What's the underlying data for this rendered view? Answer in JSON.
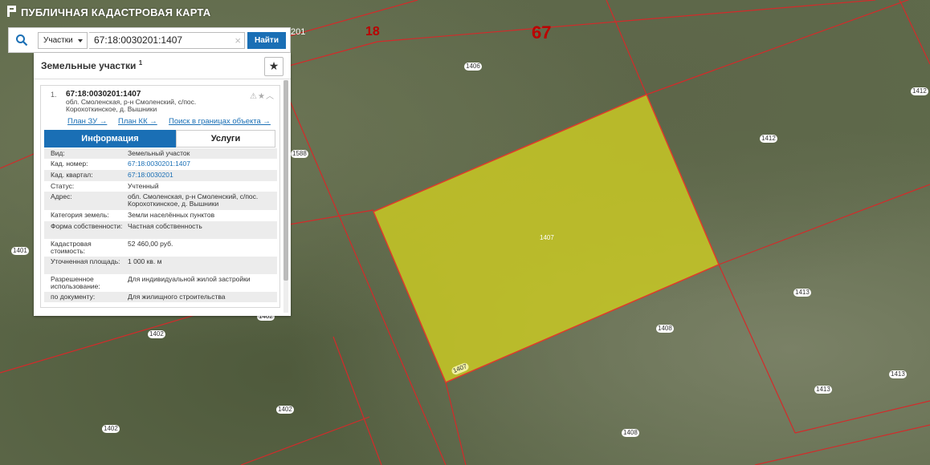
{
  "header": {
    "app_title": "ПУБЛИЧНАЯ КАДАСТРОВАЯ КАРТА"
  },
  "search": {
    "scope": "Участки",
    "query": "67:18:0030201:1407",
    "find_label": "Найти"
  },
  "panel": {
    "title": "Земельные участки",
    "count": "1",
    "item": {
      "num": "1.",
      "cad_number": "67:18:0030201:1407",
      "address": "обл. Смоленская, р-н Смоленский, с/пос. Корохоткинское, д. Вышники",
      "links": {
        "plan_zu": "План ЗУ →",
        "plan_kk": "План КК →",
        "search_within": "Поиск в границах объекта →"
      }
    },
    "tabs": {
      "info": "Информация",
      "services": "Услуги"
    },
    "rows": [
      {
        "k": "Вид:",
        "v": "Земельный участок"
      },
      {
        "k": "Кад. номер:",
        "v": "67:18:0030201:1407"
      },
      {
        "k": "Кад. квартал:",
        "v": "67:18:0030201"
      },
      {
        "k": "Статус:",
        "v": "Учтенный"
      },
      {
        "k": "Адрес:",
        "v": "обл. Смоленская, р-н Смоленский, с/пос. Корохоткинское, д. Вышники"
      },
      {
        "k": "Категория земель:",
        "v": "Земли населённых пунктов"
      },
      {
        "k": "Форма собственности:",
        "v": "Частная собственность"
      },
      {
        "k": "Кадастровая стоимость:",
        "v": "52 460,00 руб."
      },
      {
        "k": "Уточненная площадь:",
        "v": "1 000 кв. м"
      },
      {
        "k": "Разрешенное использование:",
        "v": "Для индивидуальной жилой застройки"
      },
      {
        "k": "по документу:",
        "v": "Для жилищного строительства"
      }
    ]
  },
  "map": {
    "big_labels": {
      "q18": "18",
      "q67": "67",
      "q201": "201"
    },
    "labels": {
      "l1406": "1406",
      "l1412a": "1412",
      "l1412b": "1412",
      "l1588": "1588",
      "l1407c": "1407",
      "l1407e": "1407",
      "l1401": "1401",
      "l1402a": "1402",
      "l1402b": "1402",
      "l1402c": "1402",
      "l1413a": "1413",
      "l1413b": "1413",
      "l1413c": "1413",
      "l1408a": "1408",
      "l1408b": "1408",
      "l1402d": "1402"
    },
    "highlight_color": "#c8c824"
  }
}
